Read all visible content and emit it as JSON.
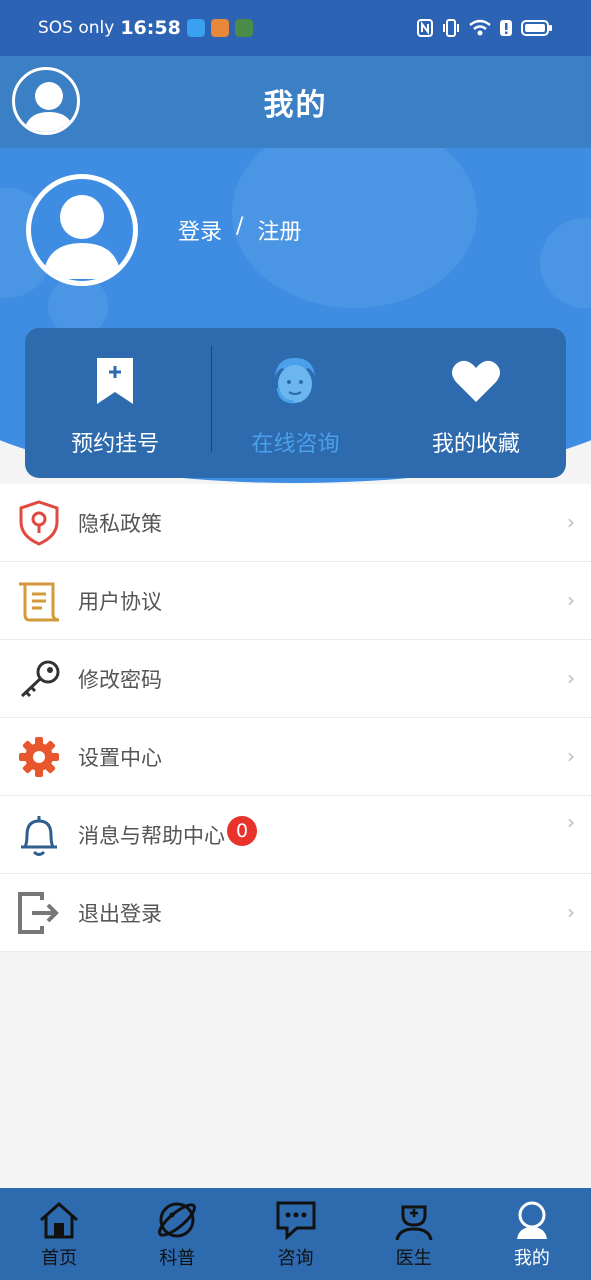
{
  "status_bar": {
    "carrier": "SOS only",
    "time": "16:58",
    "app_icons": [
      "app-icon-blue",
      "app-icon-news",
      "app-icon-game"
    ]
  },
  "header": {
    "title": "我的"
  },
  "profile": {
    "login": "登录",
    "separator": "/",
    "register": "注册"
  },
  "quick_actions": [
    {
      "label": "预约挂号",
      "icon": "bookmark-plus-icon"
    },
    {
      "label": "在线咨询",
      "icon": "customer-service-icon"
    },
    {
      "label": "我的收藏",
      "icon": "heart-icon"
    }
  ],
  "menu": [
    {
      "label": "隐私政策",
      "icon": "shield-keyhole-icon",
      "color": "#e04a3f"
    },
    {
      "label": "用户协议",
      "icon": "scroll-icon",
      "color": "#d39a3c"
    },
    {
      "label": "修改密码",
      "icon": "key-icon",
      "color": "#333333"
    },
    {
      "label": "设置中心",
      "icon": "gear-icon",
      "color": "#e8562e"
    },
    {
      "label": "消息与帮助中心",
      "icon": "bell-icon",
      "color": "#2f5e8f",
      "badge": "0"
    },
    {
      "label": "退出登录",
      "icon": "logout-icon",
      "color": "#777777"
    }
  ],
  "tabs": [
    {
      "label": "首页",
      "icon": "home-icon"
    },
    {
      "label": "科普",
      "icon": "planet-icon"
    },
    {
      "label": "咨询",
      "icon": "chat-icon"
    },
    {
      "label": "医生",
      "icon": "doctor-icon"
    },
    {
      "label": "我的",
      "icon": "profile-icon",
      "active": true
    }
  ],
  "colors": {
    "primary": "#2e6aae",
    "hero": "#3e8de3",
    "badge": "#e8322b"
  }
}
